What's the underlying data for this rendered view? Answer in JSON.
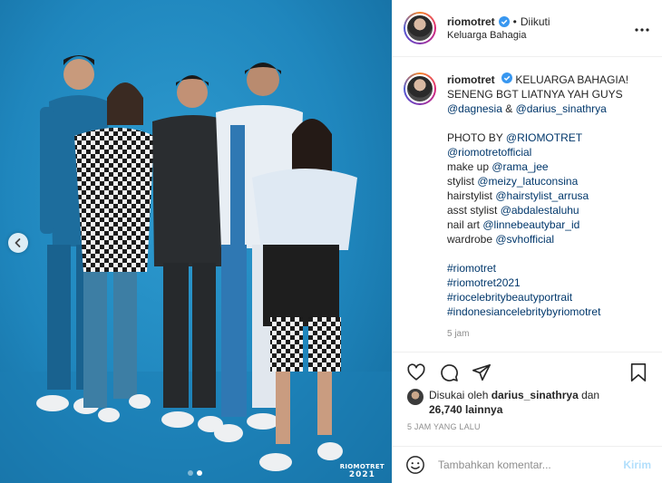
{
  "photo": {
    "watermark_line1": "RIOMOTRET",
    "watermark_line2": "2021",
    "prev_icon": "chevron-left-icon",
    "slide_count": 2,
    "active_slide": 2
  },
  "header": {
    "username": "riomotret",
    "separator": "•",
    "follow_status": "Diikuti",
    "location": "Keluarga Bahagia",
    "more_icon": "more-icon"
  },
  "caption": {
    "username": "riomotret",
    "lines": [
      {
        "text": "KELUARGA BAHAGIA!"
      },
      {
        "text": "SENENG BGT LIATNYA YAH GUYS"
      },
      {
        "parts": [
          {
            "t": "@dagnesia",
            "tag": true
          },
          {
            "t": " & ",
            "tag": false
          },
          {
            "t": "@darius_sinathrya",
            "tag": true
          }
        ]
      },
      {
        "blank": true
      },
      {
        "parts": [
          {
            "t": "PHOTO BY ",
            "tag": false
          },
          {
            "t": "@RIOMOTRET",
            "tag": true
          }
        ]
      },
      {
        "parts": [
          {
            "t": "@riomotretofficial",
            "tag": true
          }
        ]
      },
      {
        "parts": [
          {
            "t": "make up ",
            "tag": false
          },
          {
            "t": "@rama_jee",
            "tag": true
          }
        ]
      },
      {
        "parts": [
          {
            "t": "stylist ",
            "tag": false
          },
          {
            "t": "@meizy_latuconsina",
            "tag": true
          }
        ]
      },
      {
        "parts": [
          {
            "t": "hairstylist ",
            "tag": false
          },
          {
            "t": "@hairstylist_arrusa",
            "tag": true
          }
        ]
      },
      {
        "parts": [
          {
            "t": "asst stylist ",
            "tag": false
          },
          {
            "t": "@abdalestaluhu",
            "tag": true
          }
        ]
      },
      {
        "parts": [
          {
            "t": "nail art ",
            "tag": false
          },
          {
            "t": "@linnebeautybar_id",
            "tag": true
          }
        ]
      },
      {
        "parts": [
          {
            "t": "wardrobe ",
            "tag": false
          },
          {
            "t": "@svhofficial",
            "tag": true
          }
        ]
      },
      {
        "blank": true
      },
      {
        "parts": [
          {
            "t": "#riomotret",
            "tag": true
          }
        ]
      },
      {
        "parts": [
          {
            "t": "#riomotret2021",
            "tag": true
          }
        ]
      },
      {
        "parts": [
          {
            "t": "#riocelebritybeautyportrait",
            "tag": true
          }
        ]
      },
      {
        "parts": [
          {
            "t": "#indonesiancelebritybyriomotret",
            "tag": true
          }
        ]
      }
    ],
    "time": "5 jam"
  },
  "likes": {
    "prefix": "Disukai oleh ",
    "user": "darius_sinathrya",
    "mid": " dan",
    "count": "26,740 lainnya"
  },
  "post_time": "5 JAM YANG LALU",
  "comment": {
    "placeholder": "Tambahkan komentar...",
    "send_label": "Kirim"
  },
  "colors": {
    "link": "#00376b",
    "verified": "#3897f0",
    "muted": "#8e8e8e",
    "send_disabled": "#b2dffc",
    "photo_bg": "#1f86bd"
  }
}
